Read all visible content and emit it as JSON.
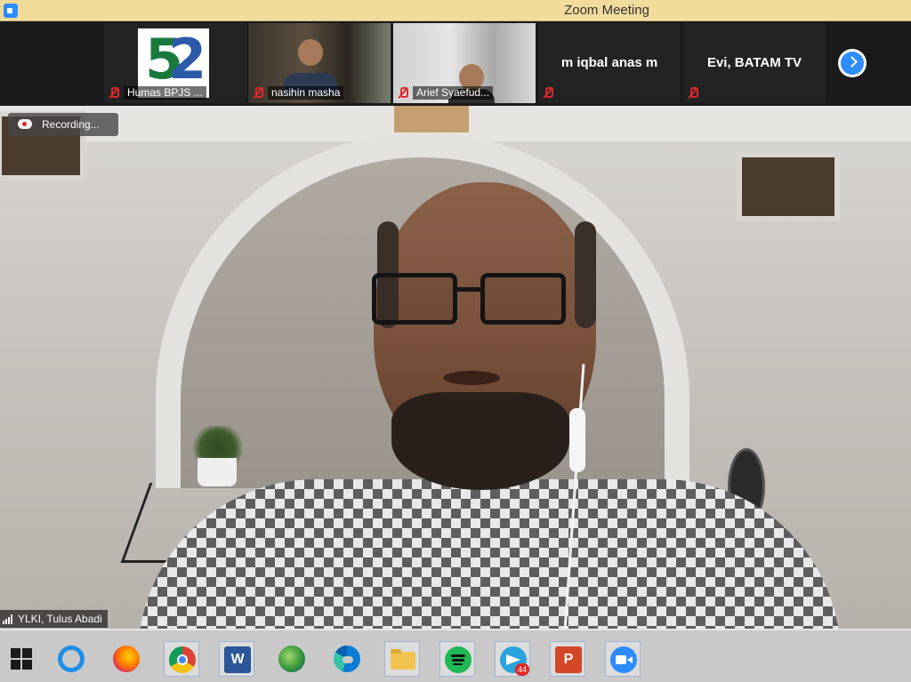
{
  "window": {
    "title": "Zoom Meeting"
  },
  "gallery": {
    "participants": [
      {
        "name": "Humas BPJS ...",
        "muted": true,
        "video": "logo"
      },
      {
        "name": "nasihin masha",
        "muted": true,
        "video": "camera"
      },
      {
        "name": "Arief Syaefud...",
        "muted": true,
        "video": "camera"
      },
      {
        "name": "m iqbal anas m",
        "muted": true,
        "video": "off"
      },
      {
        "name": "Evi, BATAM TV",
        "muted": true,
        "video": "off"
      }
    ],
    "next_page_icon": "chevron-right-icon"
  },
  "recording": {
    "label": "Recording..."
  },
  "main_speaker": {
    "name": "YLKI, Tulus Abadi"
  },
  "taskbar": {
    "items": [
      {
        "name": "start-button",
        "icon": "windows-icon"
      },
      {
        "name": "internet-explorer",
        "icon": "internet-explorer-icon"
      },
      {
        "name": "firefox",
        "icon": "firefox-icon"
      },
      {
        "name": "chrome",
        "icon": "chrome-icon"
      },
      {
        "name": "word",
        "icon": "word-icon",
        "letter": "W"
      },
      {
        "name": "internet-download-manager",
        "icon": "idm-icon"
      },
      {
        "name": "edge",
        "icon": "edge-icon"
      },
      {
        "name": "file-explorer",
        "icon": "folder-icon"
      },
      {
        "name": "spotify",
        "icon": "spotify-icon"
      },
      {
        "name": "telegram",
        "icon": "telegram-icon",
        "badge": "44"
      },
      {
        "name": "powerpoint",
        "icon": "powerpoint-icon",
        "letter": "P"
      },
      {
        "name": "zoom",
        "icon": "zoom-icon"
      }
    ]
  },
  "colors": {
    "titlebar": "#f2dc9c",
    "zoom_blue": "#2d8cff",
    "muted_red": "#e02828"
  }
}
